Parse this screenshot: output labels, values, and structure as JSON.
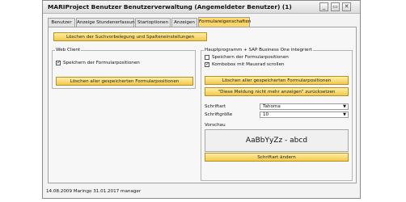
{
  "window": {
    "title": "MARIProject Benutzer Benutzerverwaltung (Angemeldeter Benutzer) (1)",
    "controls": [
      "_",
      "▭",
      "✕"
    ]
  },
  "tabs": [
    {
      "label": "Benutzer",
      "active": false
    },
    {
      "label": "Anzeige Stundenerfassung",
      "active": false
    },
    {
      "label": "Startoptionen",
      "active": false
    },
    {
      "label": "Anzeigen",
      "active": false
    },
    {
      "label": "Formulareigenschaften",
      "active": true
    }
  ],
  "main": {
    "clear_search_button": "Löschen der Suchvorbelegung und Spalteneinstellungen"
  },
  "web_client": {
    "title": "Web Client",
    "save_positions_label": "Speichern der Formularpositionen",
    "save_positions_checked": true,
    "clear_positions_button": "Löschen aller gespeicherten Formularpositionen"
  },
  "main_program": {
    "title": "Hauptprogramm + SAP Business One integriert",
    "save_positions_label": "Speichern der Formularpositionen",
    "save_positions_checked": false,
    "combobox_scroll_label": "Kombobox mit Mausrad scrollen",
    "combobox_scroll_checked": true,
    "clear_positions_button": "Löschen aller gespeicherten Formularpositionen",
    "reset_dont_show_button": "\"Diese Meldung nicht mehr anzeigen\" zurücksetzen",
    "font_label": "Schriftart",
    "font_value": "Tahoma",
    "font_size_label": "Schriftgröße",
    "font_size_value": "10",
    "preview_label": "Vorschau",
    "preview_text": "AaBbYyZz - abcd",
    "change_font_button": "Schriftart ändern"
  },
  "status_bar": {
    "text": "14.08.2009 Maringo  31.01.2017 manager"
  },
  "colors": {
    "accent": "#f3c94a",
    "active_tab": "#ffd76a"
  }
}
